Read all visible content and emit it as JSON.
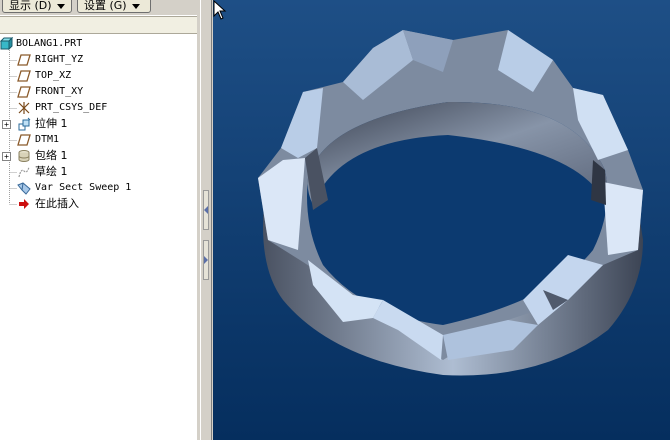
{
  "toolbar": {
    "display_label": "显示 (D)",
    "settings_label": "设置 (G)"
  },
  "tree": {
    "items": [
      {
        "label": "BOLANG1.PRT",
        "icon": "part-icon",
        "expandable": false
      },
      {
        "label": "RIGHT_YZ",
        "icon": "datum-plane-icon",
        "expandable": false
      },
      {
        "label": "TOP_XZ",
        "icon": "datum-plane-icon",
        "expandable": false
      },
      {
        "label": "FRONT_XY",
        "icon": "datum-plane-icon",
        "expandable": false
      },
      {
        "label": "PRT_CSYS_DEF",
        "icon": "coordinate-system-icon",
        "expandable": false
      },
      {
        "label": "拉伸 1",
        "icon": "extrude-icon",
        "expandable": true
      },
      {
        "label": "DTM1",
        "icon": "datum-plane-icon",
        "expandable": false
      },
      {
        "label": "包络 1",
        "icon": "wrap-icon",
        "expandable": true
      },
      {
        "label": "草绘 1",
        "icon": "sketch-icon",
        "expandable": false
      },
      {
        "label": "Var Sect Sweep 1",
        "icon": "sweep-icon",
        "expandable": false
      },
      {
        "label": "在此插入",
        "icon": "insert-arrow-icon",
        "expandable": false
      }
    ]
  },
  "colors": {
    "viewport_top": "#1e4f86",
    "viewport_bottom": "#052e5e",
    "model_face_light": "#c4d6ee",
    "model_face_dark": "#3a4150",
    "insert_arrow": "#cc1010"
  }
}
